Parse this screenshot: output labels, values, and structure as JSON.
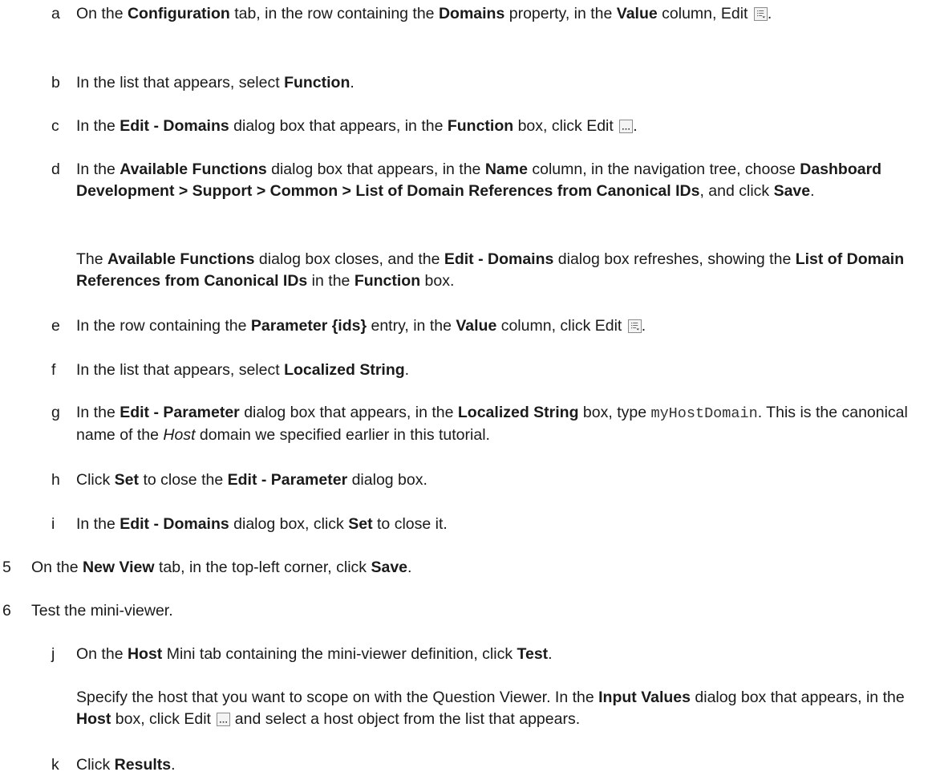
{
  "steps": [
    {
      "label": "a",
      "parts": [
        {
          "t": "On the "
        },
        {
          "b": "Configuration"
        },
        {
          "t": " tab, in the row containing the "
        },
        {
          "b": "Domains"
        },
        {
          "t": " property, in the "
        },
        {
          "b": "Value"
        },
        {
          "t": " column, Edit "
        },
        {
          "icon": "list-edit-icon"
        },
        {
          "t": "."
        }
      ]
    },
    {
      "label": "b",
      "parts": [
        {
          "t": "In the list that appears, select "
        },
        {
          "b": "Function"
        },
        {
          "t": "."
        }
      ]
    },
    {
      "label": "c",
      "parts": [
        {
          "t": "In the "
        },
        {
          "b": "Edit - Domains"
        },
        {
          "t": " dialog box that appears, in the "
        },
        {
          "b": "Function"
        },
        {
          "t": " box, click Edit "
        },
        {
          "icon": "ellipsis-edit-icon"
        },
        {
          "t": "."
        }
      ]
    },
    {
      "label": "d",
      "parts": [
        {
          "t": "In the "
        },
        {
          "b": "Available Functions"
        },
        {
          "t": " dialog box that appears, in the "
        },
        {
          "b": "Name"
        },
        {
          "t": " column, in the navigation tree, choose "
        },
        {
          "b": "Dashboard Development > Support > Common > List of Domain References from Canonical IDs"
        },
        {
          "t": ", and click "
        },
        {
          "b": "Save"
        },
        {
          "t": "."
        }
      ]
    },
    {
      "label": "",
      "parts": [
        {
          "t": "The "
        },
        {
          "b": "Available Functions"
        },
        {
          "t": " dialog box closes, and the "
        },
        {
          "b": "Edit - Domains"
        },
        {
          "t": " dialog box refreshes, showing the "
        },
        {
          "b": "List of Domain References from Canonical IDs"
        },
        {
          "t": " in the "
        },
        {
          "b": "Function"
        },
        {
          "t": " box."
        }
      ]
    },
    {
      "label": "e",
      "parts": [
        {
          "t": "In the row containing the "
        },
        {
          "b": "Parameter {ids}"
        },
        {
          "t": " entry, in the "
        },
        {
          "b": "Value"
        },
        {
          "t": " column, click Edit "
        },
        {
          "icon": "list-edit-icon"
        },
        {
          "t": "."
        }
      ]
    },
    {
      "label": "f",
      "parts": [
        {
          "t": "In the list that appears, select "
        },
        {
          "b": "Localized String"
        },
        {
          "t": "."
        }
      ]
    },
    {
      "label": "g",
      "parts": [
        {
          "t": "In the "
        },
        {
          "b": "Edit - Parameter"
        },
        {
          "t": " dialog box that appears, in the "
        },
        {
          "b": "Localized String"
        },
        {
          "t": " box, type "
        },
        {
          "code": "myHostDomain"
        },
        {
          "t": ". This is the canonical name of the "
        },
        {
          "i": "Host"
        },
        {
          "t": " domain we specified earlier in this tutorial."
        }
      ]
    },
    {
      "label": "h",
      "parts": [
        {
          "t": "Click "
        },
        {
          "b": "Set"
        },
        {
          "t": " to close the "
        },
        {
          "b": "Edit - Parameter"
        },
        {
          "t": " dialog box."
        }
      ]
    },
    {
      "label": "i",
      "parts": [
        {
          "t": "In the "
        },
        {
          "b": "Edit - Domains"
        },
        {
          "t": " dialog box, click "
        },
        {
          "b": "Set"
        },
        {
          "t": " to close it."
        }
      ]
    },
    {
      "label": "5",
      "parts": [
        {
          "t": "On the "
        },
        {
          "b": "New View"
        },
        {
          "t": " tab, in the top-left corner, click "
        },
        {
          "b": "Save"
        },
        {
          "t": "."
        }
      ]
    },
    {
      "label": "6",
      "parts": [
        {
          "t": "Test the mini-viewer."
        }
      ]
    },
    {
      "label": "j",
      "parts": [
        {
          "t": "On the "
        },
        {
          "b": "Host"
        },
        {
          "t": " Mini tab containing the mini-viewer definition, click "
        },
        {
          "b": "Test"
        },
        {
          "t": "."
        }
      ]
    },
    {
      "label": "",
      "parts": [
        {
          "t": "Specify the host that you want to scope on with the Question Viewer. In the "
        },
        {
          "b": "Input Values"
        },
        {
          "t": " dialog box that appears, in the "
        },
        {
          "b": "Host"
        },
        {
          "t": " box, click Edit "
        },
        {
          "icon": "ellipsis-edit-icon"
        },
        {
          "t": " and select a host object from the list that appears."
        }
      ]
    },
    {
      "label": "k",
      "parts": [
        {
          "t": "Click "
        },
        {
          "b": "Results"
        },
        {
          "t": "."
        }
      ]
    }
  ]
}
